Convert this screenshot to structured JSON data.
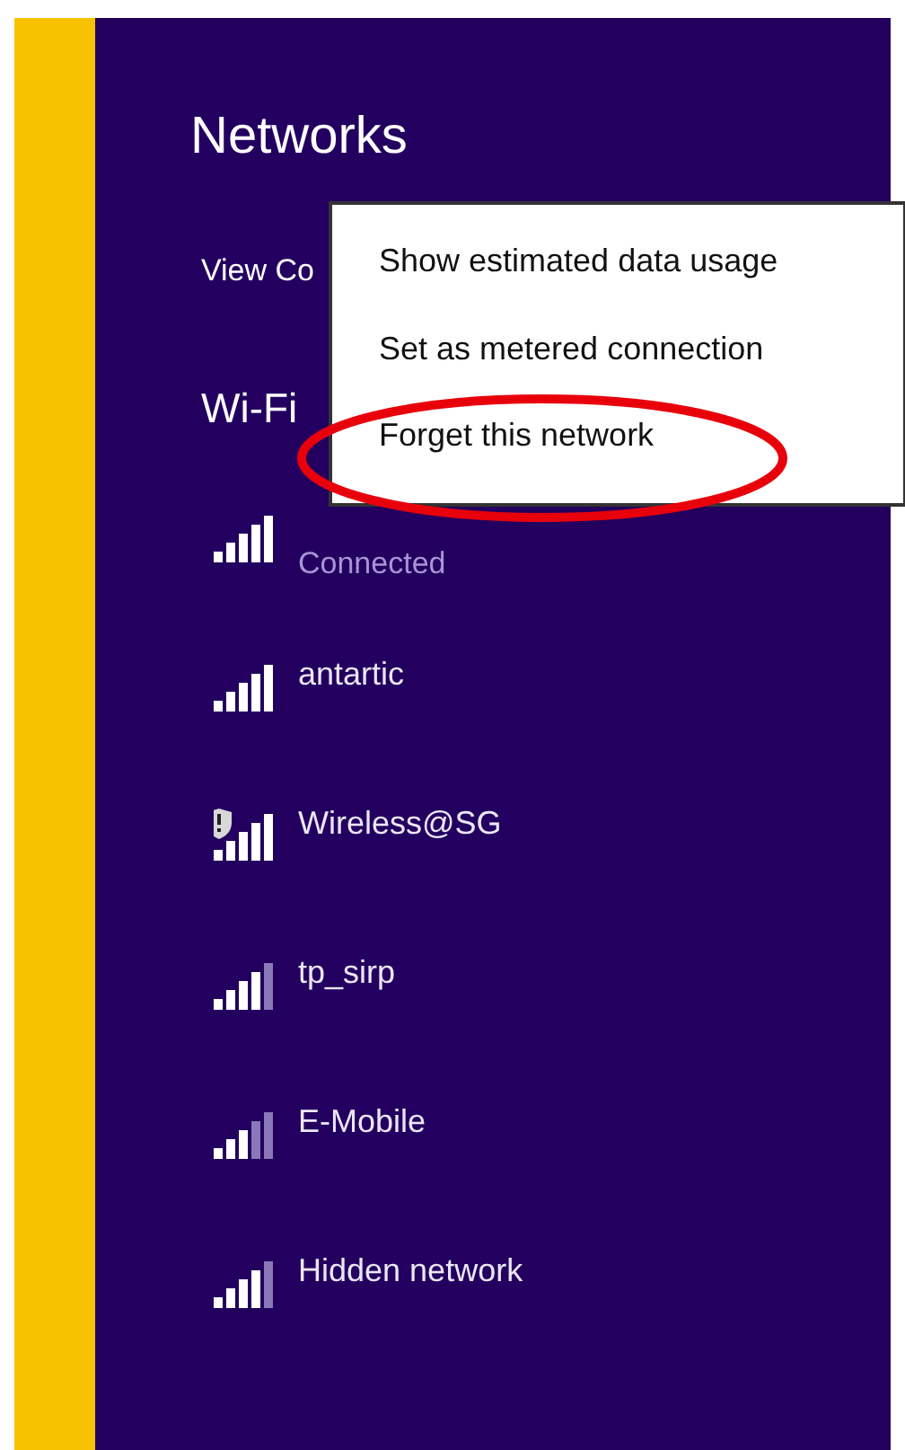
{
  "panel": {
    "title": "Networks",
    "view_link": "View Co",
    "section": "Wi-Fi"
  },
  "networks": [
    {
      "status": "Connected",
      "kind": "strong",
      "warning": false
    },
    {
      "name": "antartic",
      "kind": "strong",
      "warning": false
    },
    {
      "name": "Wireless@SG",
      "kind": "strong",
      "warning": true
    },
    {
      "name": "tp_sirp",
      "kind": "good",
      "warning": false
    },
    {
      "name": "E-Mobile",
      "kind": "fair",
      "warning": false
    },
    {
      "name": "Hidden network",
      "kind": "good",
      "warning": false
    }
  ],
  "context_menu": [
    {
      "label": "Show estimated data usage",
      "circled": false
    },
    {
      "label": "Set as metered connection",
      "circled": false
    },
    {
      "label": "Forget this network",
      "circled": true
    }
  ]
}
